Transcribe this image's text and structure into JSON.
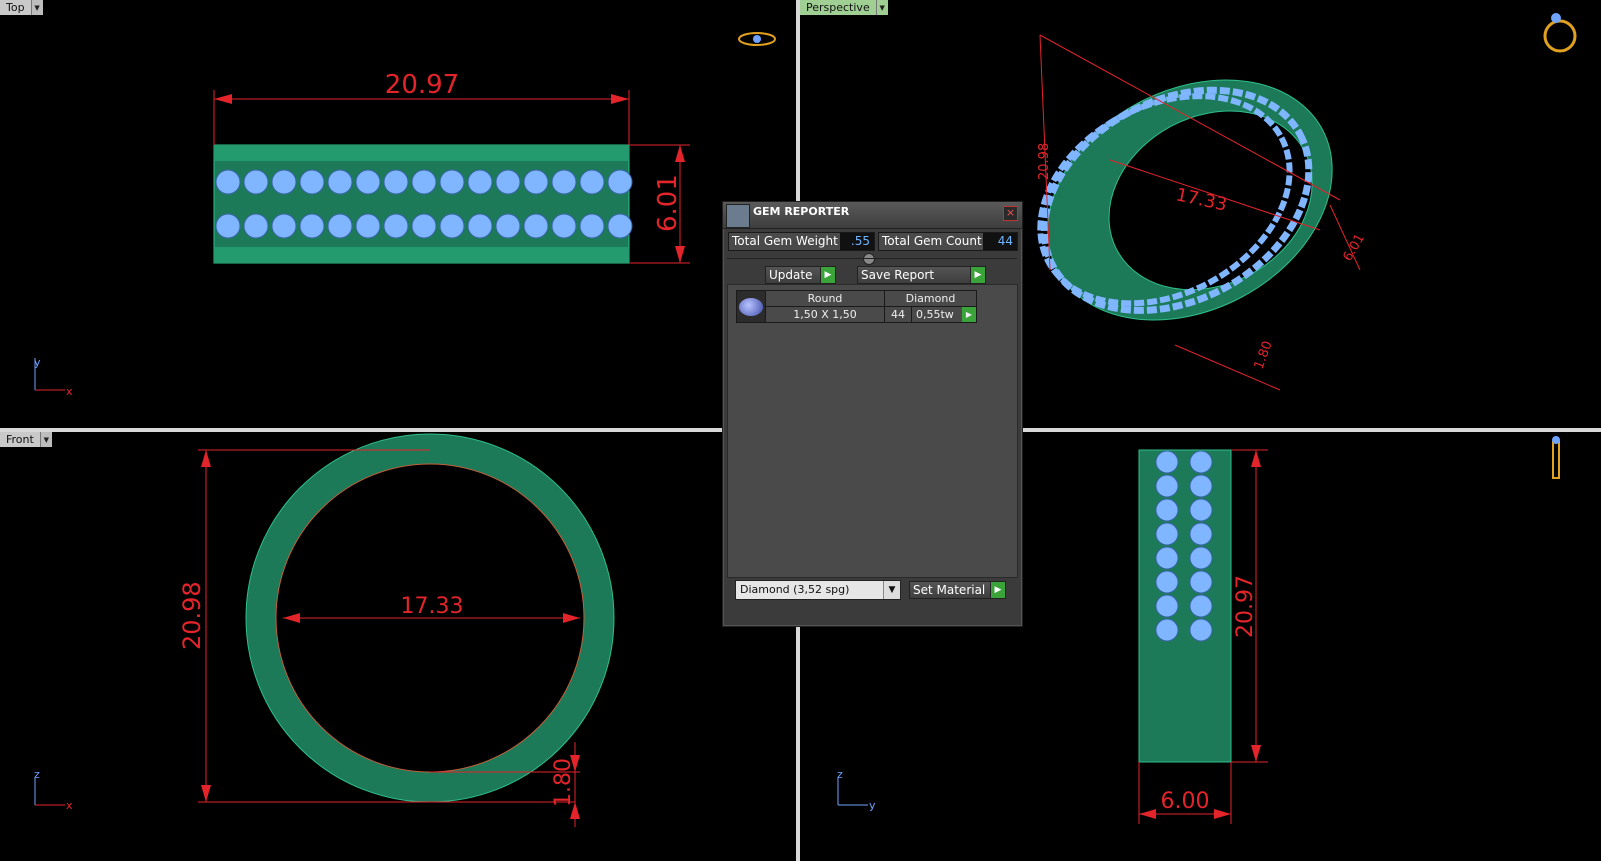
{
  "viewports": {
    "top": {
      "label": "Top",
      "dim_width": "20.97",
      "dim_height": "6.01",
      "axis_a": "y",
      "axis_b": "x"
    },
    "perspective": {
      "label": "Perspective",
      "dim_height": "20.98",
      "dim_inner": "17.33",
      "dim_width": "6.01",
      "dim_thickness": "1.80"
    },
    "front": {
      "label": "Front",
      "dim_height": "20.98",
      "dim_inner": "17.33",
      "dim_thickness": "1.80",
      "axis_a": "z",
      "axis_b": "x"
    },
    "side": {
      "dim_height": "20.97",
      "dim_width": "6.00",
      "axis_a": "z",
      "axis_b": "y"
    }
  },
  "gem_reporter": {
    "title": "GEM REPORTER",
    "close": "×",
    "total_weight_label": "Total Gem Weight",
    "total_weight_value": ".55",
    "total_count_label": "Total Gem Count",
    "total_count_value": "44",
    "update_label": "Update",
    "save_label": "Save Report",
    "table": {
      "header": [
        "Round",
        "Diamond"
      ],
      "row": {
        "size": "1,50 X 1,50",
        "count": "44",
        "weight": "0,55tw"
      }
    },
    "material_select": "Diamond     (3,52 spg)",
    "set_material_label": "Set Material"
  },
  "colors": {
    "metal": "#1e8a64",
    "gem": "#7fb6ff",
    "dimension": "#e3242b"
  }
}
